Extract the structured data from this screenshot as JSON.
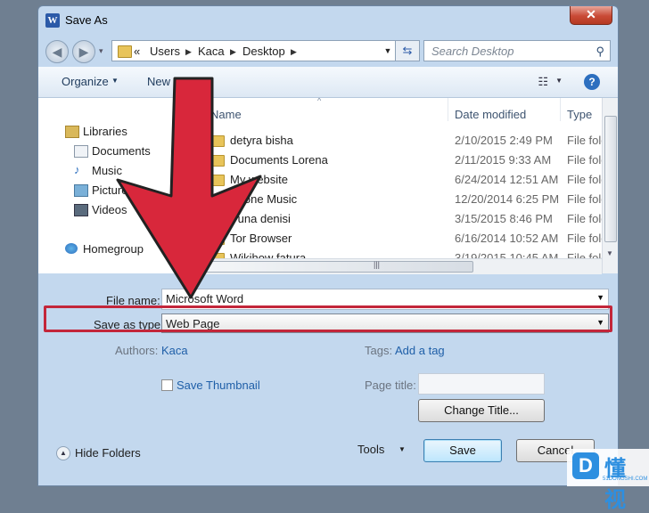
{
  "window": {
    "title": "Save As",
    "app_icon": "word-icon",
    "close_glyph": "✕"
  },
  "nav": {
    "back_glyph": "◀",
    "forward_glyph": "▶",
    "recent_glyph": "▾",
    "breadcrumb": [
      "«",
      "Users",
      "Kaca",
      "Desktop"
    ],
    "crumb_sep": "▶",
    "refresh_glyph": "⇆",
    "search_placeholder": "Search Desktop"
  },
  "toolbar": {
    "organize": "Organize",
    "new_folder": "New",
    "dropdown_glyph": "▼",
    "help": "?",
    "views_glyph": "☷"
  },
  "sidebar": {
    "items": [
      {
        "label": "Libraries",
        "icon": "libraries-icon"
      },
      {
        "label": "Documents",
        "icon": "documents-icon"
      },
      {
        "label": "Music",
        "icon": "music-icon"
      },
      {
        "label": "Pictures",
        "icon": "pictures-icon"
      },
      {
        "label": "Videos",
        "icon": "videos-icon"
      },
      {
        "label": "Homegroup",
        "icon": "homegroup-icon"
      }
    ]
  },
  "files": {
    "columns": [
      "Name",
      "Date modified",
      "Type"
    ],
    "rows": [
      {
        "name": "detyra bisha",
        "date": "2/10/2015 2:49 PM",
        "type": "File folder"
      },
      {
        "name": "Documents Lorena",
        "date": "2/11/2015 9:33 AM",
        "type": "File folder"
      },
      {
        "name": "My website",
        "date": "6/24/2014 12:51 AM",
        "type": "File folder"
      },
      {
        "name": "Phone Music",
        "date": "12/20/2014 6:25 PM",
        "type": "File folder"
      },
      {
        "name": "Puna denisi",
        "date": "3/15/2015 8:46 PM",
        "type": "File folder"
      },
      {
        "name": "Tor Browser",
        "date": "6/16/2014 10:52 AM",
        "type": "File folder"
      },
      {
        "name": "Wikihow fatura",
        "date": "3/19/2015 10:45 AM",
        "type": "File folder"
      }
    ]
  },
  "form": {
    "file_name_label": "File name:",
    "file_name_value": "Microsoft Word",
    "save_type_label": "Save as type:",
    "save_type_value": "Web Page",
    "authors_label": "Authors:",
    "authors_value": "Kaca",
    "tags_label": "Tags:",
    "tags_value": "Add a tag",
    "save_thumbnail": "Save Thumbnail",
    "page_title_label": "Page title:",
    "change_title": "Change Title...",
    "hide_folders": "Hide Folders",
    "tools": "Tools",
    "save": "Save",
    "cancel": "Cancel"
  },
  "watermark": {
    "text": "懂视",
    "sub": "51DONGSHI.COM",
    "logo": "D"
  },
  "colors": {
    "arrow_red": "#d8273b",
    "highlight": "#c3263a",
    "link": "#1f5fa8"
  }
}
